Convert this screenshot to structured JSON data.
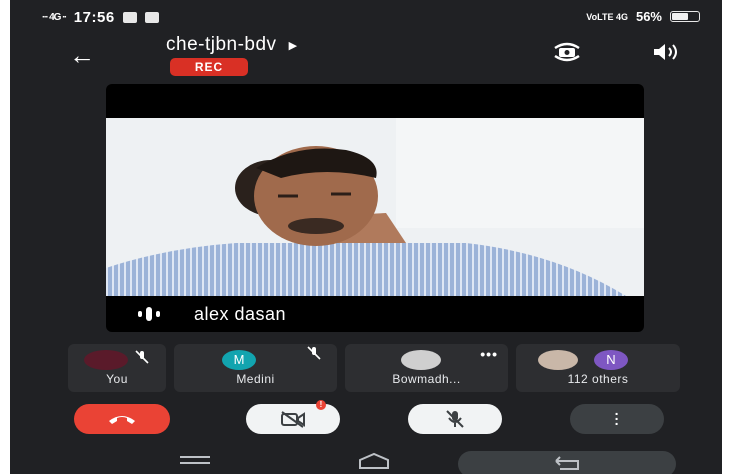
{
  "status_bar": {
    "signal_left": "∙∙∙ 4G ∙∙",
    "time": "17:56",
    "net_right": "VoLTE 4G",
    "battery": "56%",
    "battery_level": 0.56
  },
  "header": {
    "meeting_code": "che-tjbn-bdv",
    "rec_label": "REC"
  },
  "main_video": {
    "speaker_name": "alex dasan"
  },
  "participants": [
    {
      "label": "You",
      "muted": true
    },
    {
      "label": "Medini",
      "initial": "M",
      "muted": true,
      "avatar_color": "#12a4af"
    },
    {
      "label": "Bowmadh...",
      "more": "•••"
    },
    {
      "label": "112 others",
      "initial": "N",
      "avatar_color": "#7e57c2"
    }
  ],
  "controls": {
    "end_call": "end-call",
    "camera": "camera-off",
    "camera_notif": "!",
    "mic": "mic-off",
    "more": "more-options"
  },
  "colors": {
    "background": "#202124",
    "tile": "#2d2e31",
    "end_call": "#ea4335",
    "rec": "#d93025"
  }
}
